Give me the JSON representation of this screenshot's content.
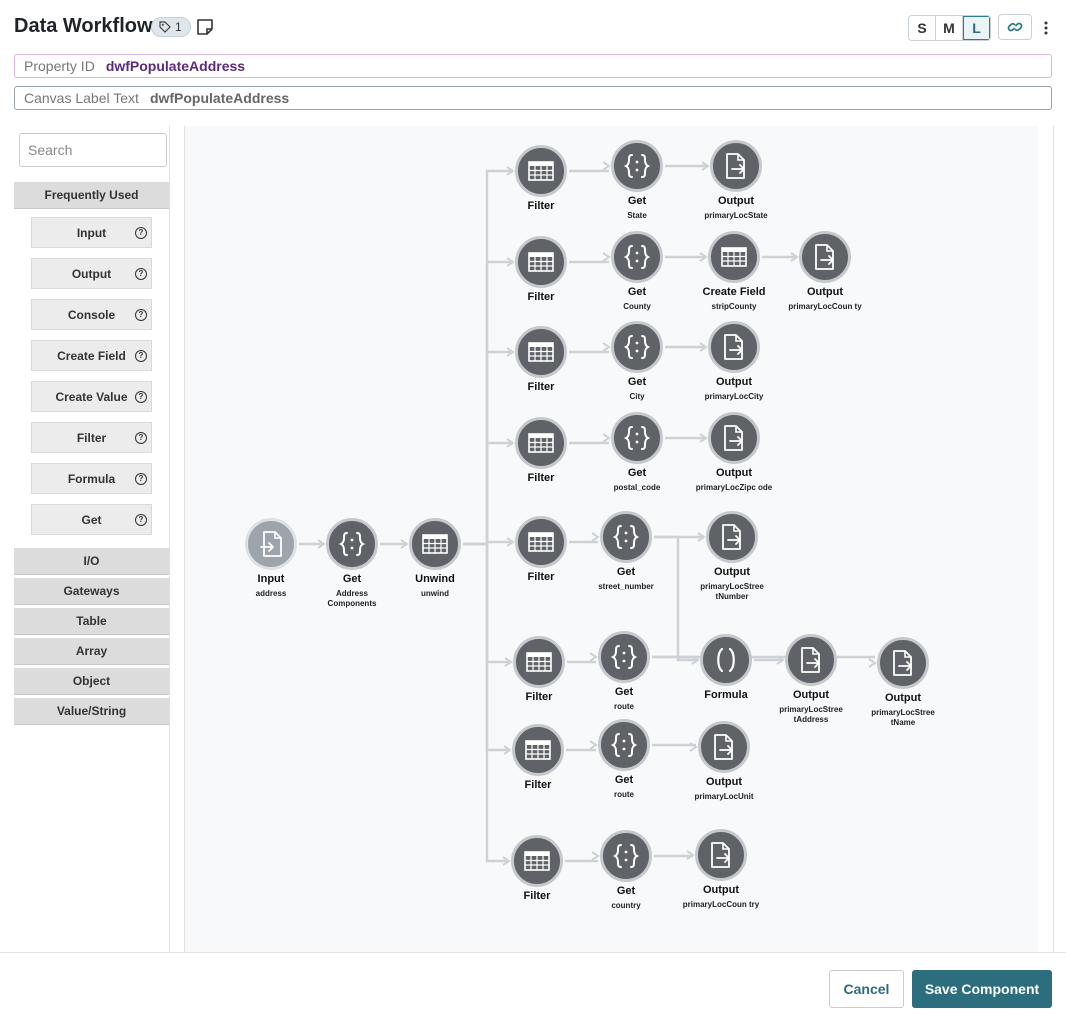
{
  "header": {
    "title": "Data Workflow",
    "tag_count": "1",
    "sizes": [
      "S",
      "M",
      "L"
    ],
    "active_size": "L"
  },
  "fields": {
    "property_id_label": "Property ID",
    "property_id_value": "dwfPopulateAddress",
    "canvas_label_label": "Canvas Label Text",
    "canvas_label_value": "dwfPopulateAddress"
  },
  "palette": {
    "search_placeholder": "Search",
    "frequently_used": "Frequently Used",
    "items": [
      "Input",
      "Output",
      "Console",
      "Create Field",
      "Create Value",
      "Filter",
      "Formula",
      "Get"
    ],
    "help_glyph": "?",
    "sections": [
      "I/O",
      "Gateways",
      "Table",
      "Array",
      "Object",
      "Value/String"
    ]
  },
  "nodes": [
    {
      "id": "n-input",
      "type": "input",
      "label": "Input",
      "sub": "address"
    },
    {
      "id": "n-get-addr",
      "type": "get",
      "label": "Get",
      "sub": "Address Components"
    },
    {
      "id": "n-unwind",
      "type": "table",
      "label": "Unwind",
      "sub": "unwind"
    },
    {
      "id": "n-f1",
      "type": "table",
      "label": "Filter",
      "sub": ""
    },
    {
      "id": "n-g1",
      "type": "get",
      "label": "Get",
      "sub": "State"
    },
    {
      "id": "n-o1",
      "type": "output",
      "label": "Output",
      "sub": "primaryLocState"
    },
    {
      "id": "n-f2",
      "type": "table",
      "label": "Filter",
      "sub": ""
    },
    {
      "id": "n-g2",
      "type": "get",
      "label": "Get",
      "sub": "County"
    },
    {
      "id": "n-cf2",
      "type": "table",
      "label": "Create Field",
      "sub": "stripCounty"
    },
    {
      "id": "n-o2",
      "type": "output",
      "label": "Output",
      "sub": "primaryLocCoun ty"
    },
    {
      "id": "n-f3",
      "type": "table",
      "label": "Filter",
      "sub": ""
    },
    {
      "id": "n-g3",
      "type": "get",
      "label": "Get",
      "sub": "City"
    },
    {
      "id": "n-o3",
      "type": "output",
      "label": "Output",
      "sub": "primaryLocCity"
    },
    {
      "id": "n-f4",
      "type": "table",
      "label": "Filter",
      "sub": ""
    },
    {
      "id": "n-g4",
      "type": "get",
      "label": "Get",
      "sub": "postal_code"
    },
    {
      "id": "n-o4",
      "type": "output",
      "label": "Output",
      "sub": "primaryLocZipc ode"
    },
    {
      "id": "n-f5",
      "type": "table",
      "label": "Filter",
      "sub": ""
    },
    {
      "id": "n-g5",
      "type": "get",
      "label": "Get",
      "sub": "street_number"
    },
    {
      "id": "n-o5",
      "type": "output",
      "label": "Output",
      "sub": "primaryLocStree tNumber"
    },
    {
      "id": "n-f6",
      "type": "table",
      "label": "Filter",
      "sub": ""
    },
    {
      "id": "n-g6",
      "type": "get",
      "label": "Get",
      "sub": "route"
    },
    {
      "id": "n-fx6",
      "type": "formula",
      "label": "Formula",
      "sub": ""
    },
    {
      "id": "n-o6a",
      "type": "output",
      "label": "Output",
      "sub": "primaryLocStree tAddress"
    },
    {
      "id": "n-o6b",
      "type": "output",
      "label": "Output",
      "sub": "primaryLocStree tName"
    },
    {
      "id": "n-f7",
      "type": "table",
      "label": "Filter",
      "sub": ""
    },
    {
      "id": "n-g7",
      "type": "get",
      "label": "Get",
      "sub": "route"
    },
    {
      "id": "n-o7",
      "type": "output",
      "label": "Output",
      "sub": "primaryLocUnit"
    },
    {
      "id": "n-f8",
      "type": "table",
      "label": "Filter",
      "sub": ""
    },
    {
      "id": "n-g8",
      "type": "get",
      "label": "Get",
      "sub": "country"
    },
    {
      "id": "n-o8",
      "type": "output",
      "label": "Output",
      "sub": "primaryLocCoun try"
    }
  ],
  "edges": [
    [
      "n-input",
      "n-get-addr"
    ],
    [
      "n-get-addr",
      "n-unwind"
    ],
    [
      "n-unwind",
      "n-f1"
    ],
    [
      "n-unwind",
      "n-f2"
    ],
    [
      "n-unwind",
      "n-f3"
    ],
    [
      "n-unwind",
      "n-f4"
    ],
    [
      "n-unwind",
      "n-f5"
    ],
    [
      "n-unwind",
      "n-f6"
    ],
    [
      "n-unwind",
      "n-f7"
    ],
    [
      "n-unwind",
      "n-f8"
    ],
    [
      "n-f1",
      "n-g1"
    ],
    [
      "n-g1",
      "n-o1"
    ],
    [
      "n-f2",
      "n-g2"
    ],
    [
      "n-g2",
      "n-cf2"
    ],
    [
      "n-cf2",
      "n-o2"
    ],
    [
      "n-f3",
      "n-g3"
    ],
    [
      "n-g3",
      "n-o3"
    ],
    [
      "n-f4",
      "n-g4"
    ],
    [
      "n-g4",
      "n-o4"
    ],
    [
      "n-f5",
      "n-g5"
    ],
    [
      "n-g5",
      "n-o5"
    ],
    [
      "n-g5",
      "n-fx6"
    ],
    [
      "n-f6",
      "n-g6"
    ],
    [
      "n-g6",
      "n-fx6"
    ],
    [
      "n-g6",
      "n-o6b"
    ],
    [
      "n-fx6",
      "n-o6a"
    ],
    [
      "n-f7",
      "n-g7"
    ],
    [
      "n-g7",
      "n-o7"
    ],
    [
      "n-f8",
      "n-g8"
    ],
    [
      "n-g8",
      "n-o8"
    ]
  ],
  "footer": {
    "cancel_label": "Cancel",
    "save_label": "Save Component"
  }
}
